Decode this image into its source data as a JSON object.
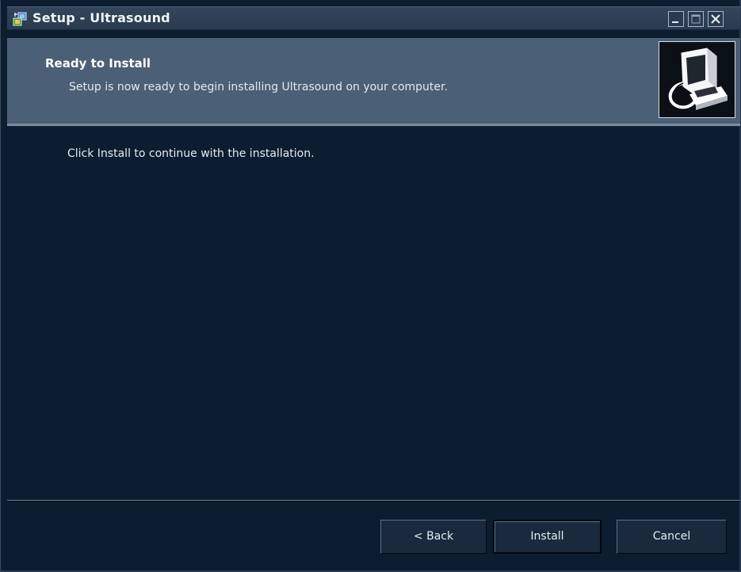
{
  "window": {
    "title": "Setup - Ultrasound",
    "controls": {
      "minimize_icon": "minimize-icon",
      "maximize_icon": "maximize-icon",
      "close_icon": "close-icon"
    },
    "app_icon": "installer-icon"
  },
  "header": {
    "title": "Ready to Install",
    "subtitle": "Setup is now ready to begin installing Ultrasound on your computer.",
    "image_icon": "computer-install-icon"
  },
  "body": {
    "instruction": "Click Install to continue with the installation."
  },
  "buttons": {
    "back": "< Back",
    "install": "Install",
    "cancel": "Cancel"
  },
  "colors": {
    "window_background": "#0c1d2f",
    "header_background": "#4b5f76",
    "titlebar_background": "#2a3b50",
    "text": "#e7ecf1"
  }
}
